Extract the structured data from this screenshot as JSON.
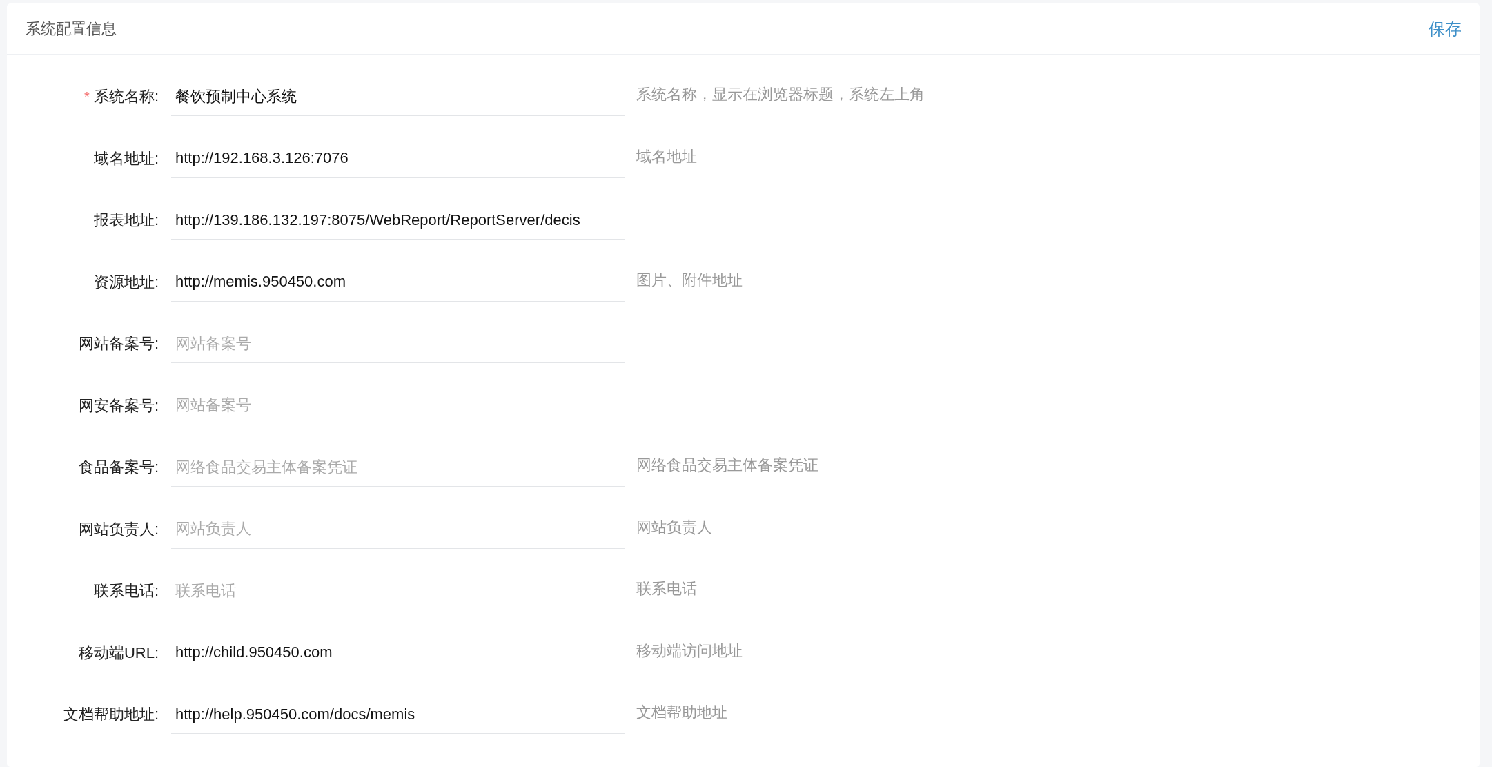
{
  "header": {
    "title": "系统配置信息",
    "save": "保存"
  },
  "fields": [
    {
      "label": "系统名称:",
      "required_mark": "*",
      "value": "餐饮预制中心系统",
      "hint": "系统名称，显示在浏览器标题，系统左上角"
    },
    {
      "label": "域名地址:",
      "value": "http://192.168.3.126:7076",
      "hint": "域名地址"
    },
    {
      "label": "报表地址:",
      "value": "http://139.186.132.197:8075/WebReport/ReportServer/decis"
    },
    {
      "label": "资源地址:",
      "value": "http://memis.950450.com",
      "hint": "图片、附件地址"
    },
    {
      "label": "网站备案号:",
      "placeholder": "网站备案号"
    },
    {
      "label": "网安备案号:",
      "placeholder": "网站备案号"
    },
    {
      "label": "食品备案号:",
      "placeholder": "网络食品交易主体备案凭证",
      "hint": "网络食品交易主体备案凭证"
    },
    {
      "label": "网站负责人:",
      "placeholder": "网站负责人",
      "hint": "网站负责人"
    },
    {
      "label": "联系电话:",
      "placeholder": "联系电话",
      "hint": "联系电话"
    },
    {
      "label": "移动端URL:",
      "value": "http://child.950450.com",
      "hint": "移动端访问地址"
    },
    {
      "label": "文档帮助地址:",
      "value": "http://help.950450.com/docs/memis",
      "hint": "文档帮助地址"
    }
  ]
}
